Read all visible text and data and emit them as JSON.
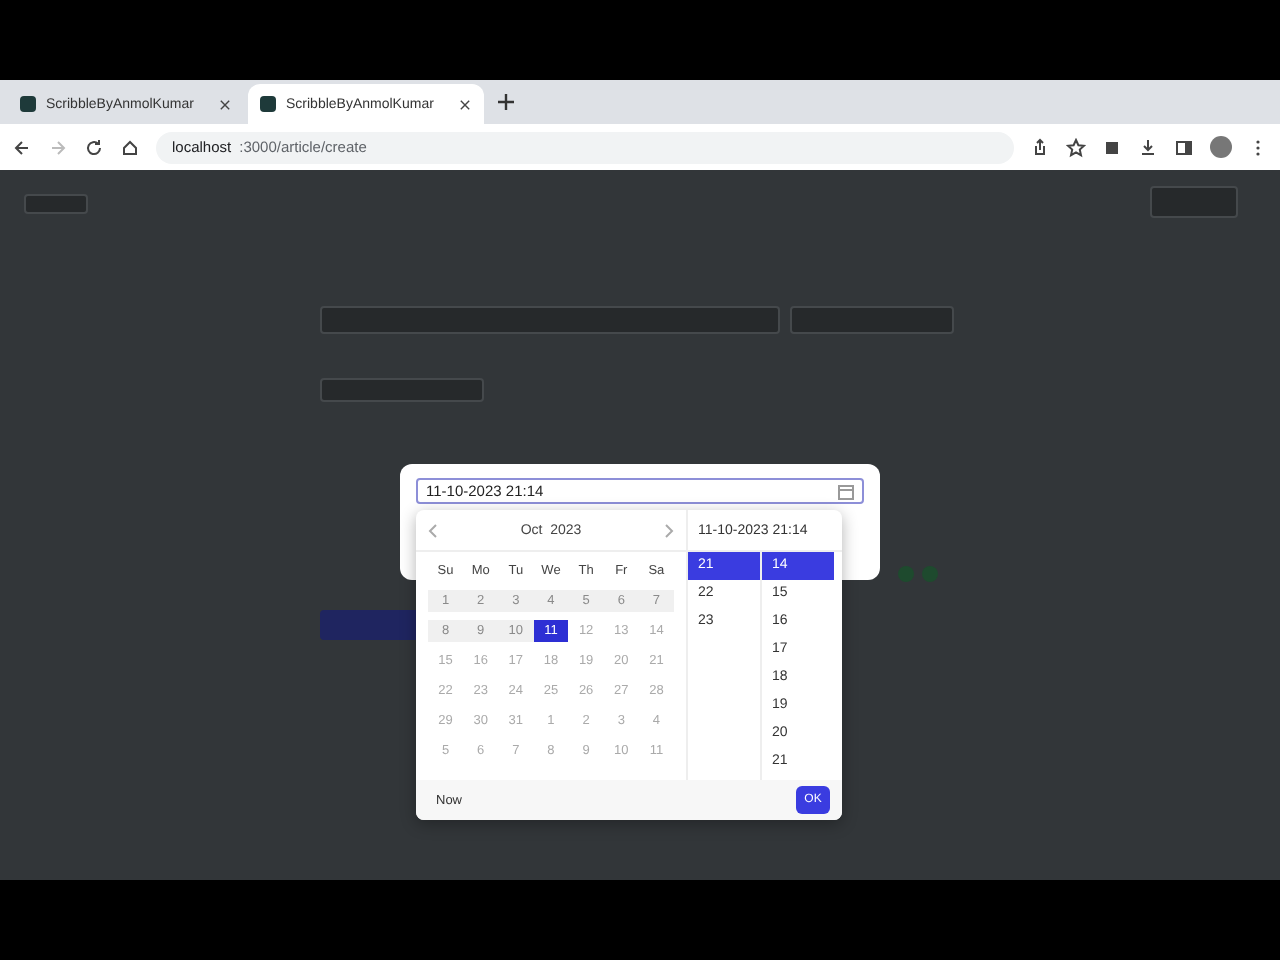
{
  "browser": {
    "tabs": [
      {
        "title": "ScribbleByAnmolKumar",
        "selected": false
      },
      {
        "title": "ScribbleByAnmolKumar",
        "selected": true
      }
    ],
    "url_host": "localhost",
    "url_path": ":3000/article/create"
  },
  "picker": {
    "value": "11-10-2023 21:14",
    "month": "Oct",
    "year": "2023",
    "time_heading": "11-10-2023 21:14",
    "weekdays": [
      "Su",
      "Mo",
      "Tu",
      "We",
      "Th",
      "Fr",
      "Sa"
    ],
    "weeks": [
      [
        {
          "d": "1",
          "kind": "past"
        },
        {
          "d": "2",
          "kind": "past"
        },
        {
          "d": "3",
          "kind": "past"
        },
        {
          "d": "4",
          "kind": "past"
        },
        {
          "d": "5",
          "kind": "past"
        },
        {
          "d": "6",
          "kind": "past"
        },
        {
          "d": "7",
          "kind": "past"
        }
      ],
      [
        {
          "d": "8",
          "kind": "past"
        },
        {
          "d": "9",
          "kind": "past"
        },
        {
          "d": "10",
          "kind": "past"
        },
        {
          "d": "11",
          "kind": "selected"
        },
        {
          "d": "12",
          "kind": "plain"
        },
        {
          "d": "13",
          "kind": "plain"
        },
        {
          "d": "14",
          "kind": "plain"
        }
      ],
      [
        {
          "d": "15",
          "kind": "plain"
        },
        {
          "d": "16",
          "kind": "plain"
        },
        {
          "d": "17",
          "kind": "plain"
        },
        {
          "d": "18",
          "kind": "plain"
        },
        {
          "d": "19",
          "kind": "plain"
        },
        {
          "d": "20",
          "kind": "plain"
        },
        {
          "d": "21",
          "kind": "plain"
        }
      ],
      [
        {
          "d": "22",
          "kind": "plain"
        },
        {
          "d": "23",
          "kind": "plain"
        },
        {
          "d": "24",
          "kind": "plain"
        },
        {
          "d": "25",
          "kind": "plain"
        },
        {
          "d": "26",
          "kind": "plain"
        },
        {
          "d": "27",
          "kind": "plain"
        },
        {
          "d": "28",
          "kind": "plain"
        }
      ],
      [
        {
          "d": "29",
          "kind": "plain"
        },
        {
          "d": "30",
          "kind": "plain"
        },
        {
          "d": "31",
          "kind": "plain"
        },
        {
          "d": "1",
          "kind": "plain"
        },
        {
          "d": "2",
          "kind": "plain"
        },
        {
          "d": "3",
          "kind": "plain"
        },
        {
          "d": "4",
          "kind": "plain"
        }
      ],
      [
        {
          "d": "5",
          "kind": "plain"
        },
        {
          "d": "6",
          "kind": "plain"
        },
        {
          "d": "7",
          "kind": "plain"
        },
        {
          "d": "8",
          "kind": "plain"
        },
        {
          "d": "9",
          "kind": "plain"
        },
        {
          "d": "10",
          "kind": "plain"
        },
        {
          "d": "11",
          "kind": "plain"
        }
      ]
    ],
    "hours": [
      {
        "label": "21",
        "selected": true
      },
      {
        "label": "22",
        "selected": false
      },
      {
        "label": "23",
        "selected": false
      }
    ],
    "minutes": [
      {
        "label": "14",
        "selected": true
      },
      {
        "label": "15",
        "selected": false
      },
      {
        "label": "16",
        "selected": false
      },
      {
        "label": "17",
        "selected": false
      },
      {
        "label": "18",
        "selected": false
      },
      {
        "label": "19",
        "selected": false
      },
      {
        "label": "20",
        "selected": false
      },
      {
        "label": "21",
        "selected": false
      }
    ],
    "now_label": "Now",
    "ok_label": "OK"
  }
}
